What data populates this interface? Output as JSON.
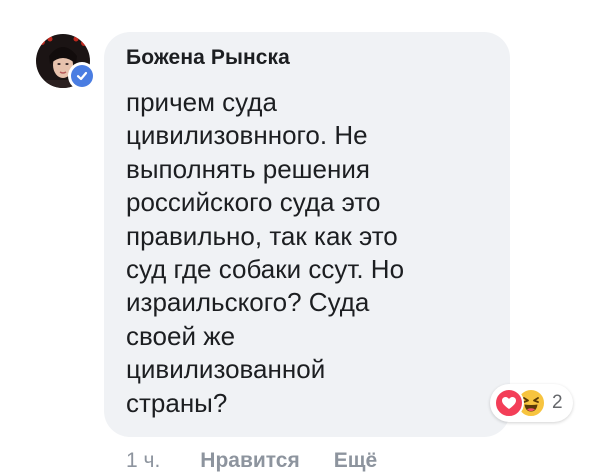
{
  "comment": {
    "author": "Божена Рынска",
    "text": "причем суда\nцивилизовнного. Не\nвыполнять решения\nроссийского суда это\nправильно, так как это\nсуд где собаки ссут. Но\nизраильского? Суда\nсвоей же\nцивилизованной\nстраны?",
    "verified": true
  },
  "reactions": {
    "icons": [
      "love-reaction-icon",
      "haha-reaction-icon"
    ],
    "count": "2"
  },
  "actions": {
    "time": "1 ч.",
    "like_label": "Нравится",
    "more_label": "Ещё"
  },
  "colors": {
    "bubble": "#f0f2f5",
    "verified": "#4a7de2",
    "love": "#f33e58",
    "haha": "#f7c43f",
    "muted": "#8d949e"
  }
}
